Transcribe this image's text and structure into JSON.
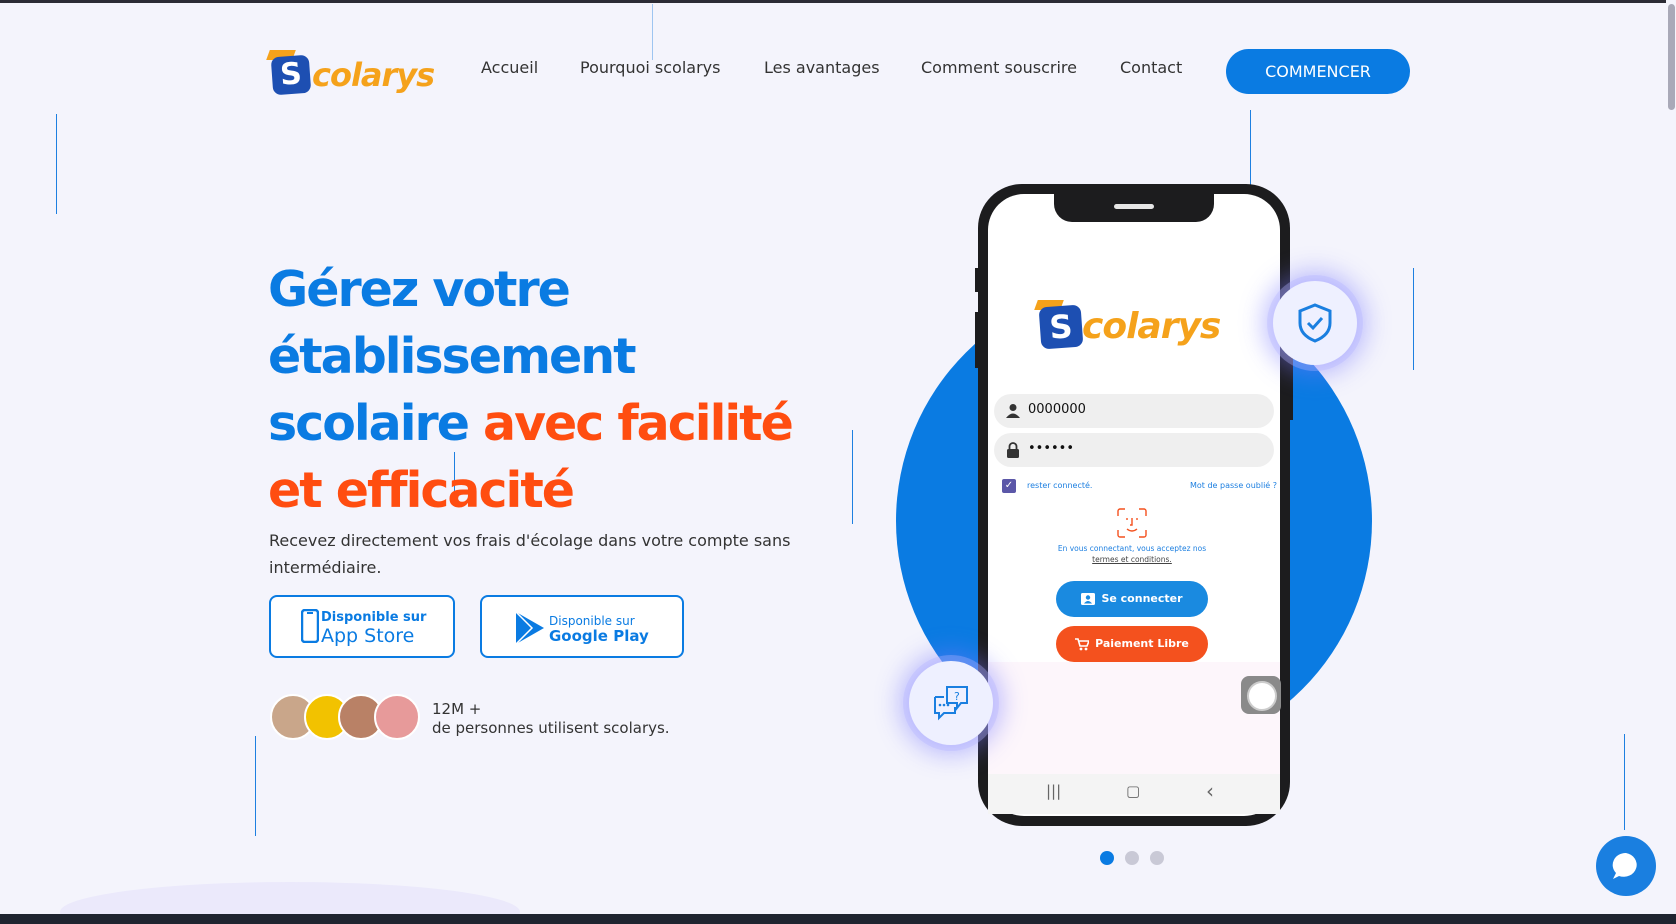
{
  "brand": {
    "logo_letter": "S",
    "logo_text": "colarys",
    "primary": "#0a7be2",
    "accent": "#ff4d10",
    "logo_orange": "#f5a21b"
  },
  "nav": {
    "items": [
      "Accueil",
      "Pourquoi scolarys",
      "Les avantages",
      "Comment souscrire",
      "Contact"
    ],
    "cta": "COMMENCER"
  },
  "hero": {
    "title_blue": "Gérez votre établissement scolaire",
    "title_orange": "avec facilité et efficacité",
    "subtitle": "Recevez directement vos frais d'écolage dans votre compte sans intermédiaire.",
    "app_store": {
      "small": "Disponible sur",
      "big": "App Store"
    },
    "google_play": {
      "small": "Disponible sur",
      "big": "Google Play"
    },
    "users_count": "12M +",
    "users_text": "de personnes utilisent scolarys."
  },
  "phone": {
    "username": "0000000",
    "password": "••••••",
    "remember": "rester connecté.",
    "forgot": "Mot de passe oublié ?",
    "terms_prefix": "En vous connectant, vous acceptez nos",
    "terms_link": "termes et conditions.",
    "login_button": "Se connecter",
    "pay_button": "Paiement Libre",
    "nav_recent": "|||",
    "nav_home": "▢",
    "nav_back": "‹"
  },
  "carousel": {
    "slides": 3,
    "active": 1
  },
  "icons": [
    "shield-check-icon",
    "chat-help-icon",
    "chat-widget-icon",
    "user-icon",
    "lock-icon",
    "face-id-icon",
    "id-card-icon",
    "cart-icon"
  ]
}
